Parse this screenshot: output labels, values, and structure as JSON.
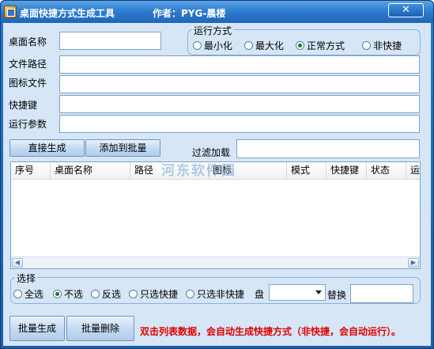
{
  "window": {
    "title": "桌面快捷方式生成工具",
    "author": "作者：PYG-晨楼",
    "close_symbol": "✕"
  },
  "form": {
    "name_label": "桌面名称",
    "path_label": "文件路径",
    "icon_label": "图标文件",
    "hotkey_label": "快捷键",
    "args_label": "运行参数",
    "name_value": "",
    "path_value": "",
    "icon_value": "",
    "hotkey_value": "",
    "args_value": ""
  },
  "run_mode": {
    "title": "运行方式",
    "options": [
      "最小化",
      "最大化",
      "正常方式",
      "非快捷"
    ],
    "selected": "正常方式"
  },
  "actions": {
    "generate_now": "直接生成",
    "add_to_batch": "添加到批量",
    "filter_label": "过滤加载",
    "filter_value": ""
  },
  "list": {
    "columns": [
      "序号",
      "桌面名称",
      "路径",
      "图标",
      "模式",
      "快捷键",
      "状态",
      "运"
    ],
    "rows": []
  },
  "watermark": "河东软件园",
  "select_group": {
    "title": "选择",
    "options": [
      "全选",
      "不选",
      "反选",
      "只选快捷",
      "只选非快捷"
    ],
    "selected": "不选",
    "drive_label": "盘",
    "drive_value": "",
    "replace_label": "替换",
    "replace_value": ""
  },
  "bottom": {
    "batch_generate": "批量生成",
    "batch_delete": "批量删除",
    "notice": "双击列表数据，会自动生成快捷方式（非快捷，会自动运行）。"
  },
  "colors": {
    "titlebar": "#2f7dd0",
    "client_bg": "#d6e6f7",
    "notice": "#e00000"
  }
}
